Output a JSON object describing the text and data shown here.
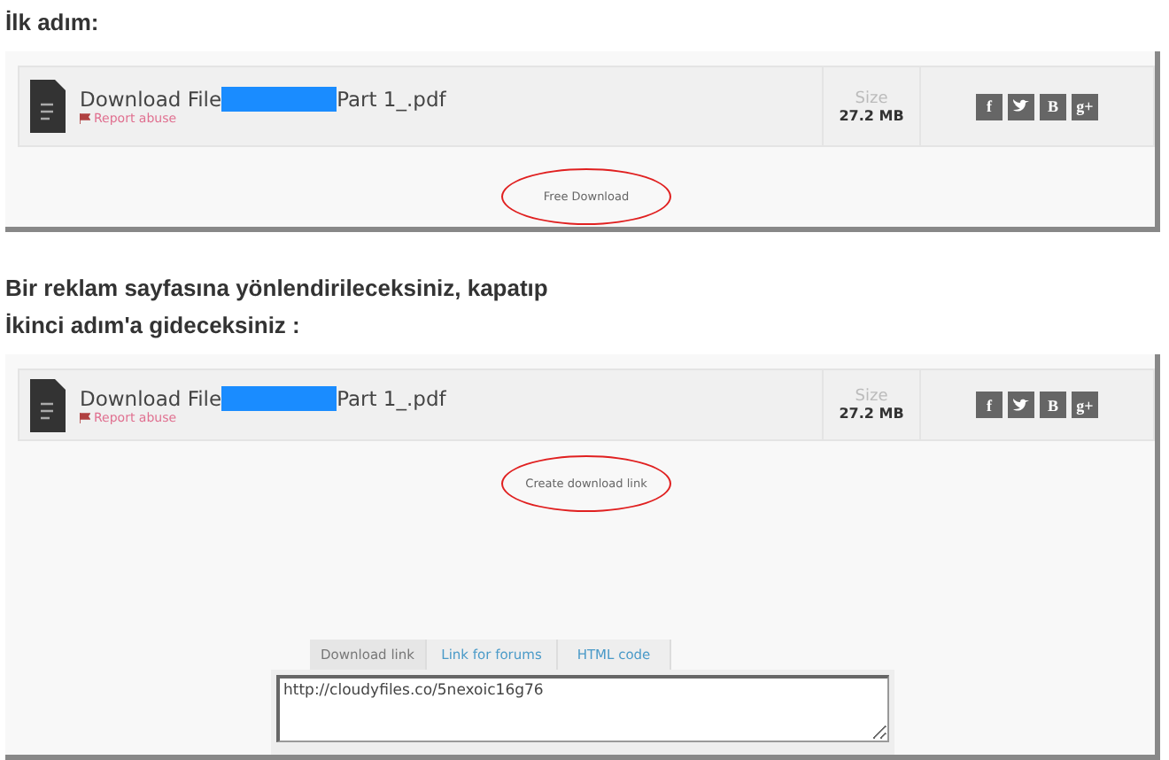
{
  "steps": [
    {
      "heading": [
        "İlk adım:"
      ],
      "file": {
        "prefix": "Download File",
        "suffix": "Part 1_.pdf",
        "report": "Report abuse",
        "size_label": "Size",
        "size": "27.2 MB"
      },
      "share": [
        {
          "kind": "text",
          "label": "f"
        },
        {
          "kind": "bird"
        },
        {
          "kind": "text",
          "label": "B"
        },
        {
          "kind": "text",
          "label": "g+"
        }
      ],
      "action": "Free Download"
    },
    {
      "heading": [
        "Bir reklam sayfasına yönlendirileceksiniz, kapatıp",
        "İkinci adım'a gideceksiniz :"
      ],
      "file": {
        "prefix": "Download File",
        "suffix": "Part 1_.pdf",
        "report": "Report abuse",
        "size_label": "Size",
        "size": "27.2 MB"
      },
      "share": [
        {
          "kind": "text",
          "label": "f"
        },
        {
          "kind": "bird"
        },
        {
          "kind": "text",
          "label": "B"
        },
        {
          "kind": "text",
          "label": "g+"
        }
      ],
      "action": "Create download link",
      "link_box": {
        "tabs": [
          {
            "label": "Download link",
            "selected": true
          },
          {
            "label": "Link for forums",
            "selected": false
          },
          {
            "label": "HTML code",
            "selected": false
          }
        ],
        "value": "http://cloudyfiles.co/5nexoic16g76"
      }
    }
  ]
}
